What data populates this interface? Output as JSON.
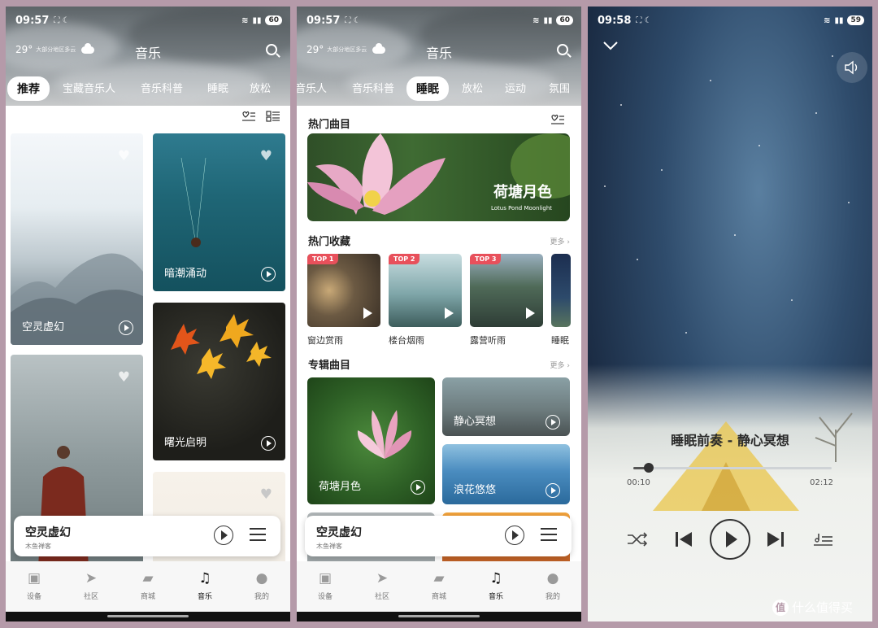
{
  "colors": {
    "accent_badge": "#e8505b",
    "active_tab_bg": "#ffffff",
    "nav_active": "#111111"
  },
  "phone1": {
    "status": {
      "time": "09:57",
      "battery": "60"
    },
    "weather": {
      "temp": "29°",
      "desc": "大部分地区多云"
    },
    "title": "音乐",
    "tabs": [
      "推荐",
      "宝藏音乐人",
      "音乐科普",
      "睡眠",
      "放松"
    ],
    "active_tab": "推荐",
    "cards": [
      {
        "label": "空灵虚幻"
      },
      {
        "label": "暗潮涌动"
      },
      {
        "label": "曙光启明"
      }
    ],
    "mini_player": {
      "title": "空灵虚幻",
      "artist": "木鱼禅客"
    },
    "nav": [
      "设备",
      "社区",
      "商城",
      "音乐",
      "我的"
    ],
    "nav_active": "音乐"
  },
  "phone2": {
    "status": {
      "time": "09:57",
      "battery": "60"
    },
    "weather": {
      "temp": "29°",
      "desc": "大部分地区多云"
    },
    "title": "音乐",
    "tabs": [
      "音乐人",
      "音乐科普",
      "睡眠",
      "放松",
      "运动",
      "氛围"
    ],
    "active_tab": "睡眠",
    "hot_tracks": {
      "title": "热门曲目",
      "banner_title": "荷塘月色",
      "banner_sub": "Lotus Pond Moonlight"
    },
    "hot_collect": {
      "title": "热门收藏",
      "more": "更多 ›",
      "items": [
        {
          "badge": "TOP 1",
          "caption": "窗边赏雨"
        },
        {
          "badge": "TOP 2",
          "caption": "楼台烟雨"
        },
        {
          "badge": "TOP 3",
          "caption": "露营听雨"
        },
        {
          "badge": "",
          "caption": "睡眠"
        }
      ]
    },
    "album": {
      "title": "专辑曲目",
      "more": "更多 ›",
      "items": [
        {
          "label": "荷塘月色"
        },
        {
          "label": "静心冥想"
        },
        {
          "label": "浪花悠悠"
        }
      ]
    },
    "mini_player": {
      "title": "空灵虚幻",
      "artist": "木鱼禅客"
    },
    "nav": [
      "设备",
      "社区",
      "商城",
      "音乐",
      "我的"
    ],
    "nav_active": "音乐"
  },
  "phone3": {
    "status": {
      "time": "09:58",
      "battery": "59"
    },
    "track_title": "睡眠前奏 - 静心冥想",
    "elapsed": "00:10",
    "duration": "02:12",
    "progress": 0.076
  },
  "watermark": {
    "text": "什么值得买"
  }
}
